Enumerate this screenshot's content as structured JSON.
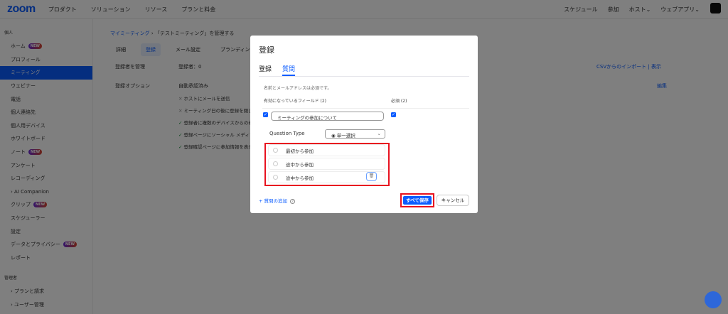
{
  "header": {
    "logo": "zoom",
    "nav": [
      "プロダクト",
      "ソリューション",
      "リソース",
      "プランと料金"
    ],
    "right": [
      "スケジュール",
      "参加",
      "ホスト⌄",
      "ウェブアプリ⌄"
    ]
  },
  "sidebar": {
    "section_personal": "個人",
    "items": [
      {
        "label": "ホーム",
        "new": "NEW"
      },
      {
        "label": "プロフィール"
      },
      {
        "label": "ミーティング",
        "active": true
      },
      {
        "label": "ウェビナー"
      },
      {
        "label": "電話"
      },
      {
        "label": "個人連絡先"
      },
      {
        "label": "個人用デバイス"
      },
      {
        "label": "ホワイトボード"
      },
      {
        "label": "ノート",
        "new": "NEW"
      },
      {
        "label": "アンケート"
      },
      {
        "label": "レコーディング"
      },
      {
        "label": "› AI Companion"
      },
      {
        "label": "クリップ",
        "new": "NEW"
      },
      {
        "label": "スケジューラー"
      },
      {
        "label": "設定"
      },
      {
        "label": "データとプライバシー",
        "new": "NEW"
      },
      {
        "label": "レポート"
      }
    ],
    "section_admin": "管理者",
    "admin_items": [
      "› プランと請求",
      "› ユーザー管理"
    ]
  },
  "main": {
    "breadcrumb_link": "マイミーティング",
    "breadcrumb_sep": " › ",
    "breadcrumb_current": "「テストミーティング」を管理する",
    "tabs": [
      "詳細",
      "登録",
      "メール設定",
      "ブランディング"
    ],
    "manage_label": "登録者を管理",
    "registrants": "登録者：0",
    "csv_import": "CSVからのインポート",
    "view": "表示",
    "options_label": "登録オプション",
    "edit": "編集",
    "auto_approve": "自動承認済み",
    "options": [
      {
        "mark": "✕",
        "text": "ホストにメールを送信"
      },
      {
        "mark": "✕",
        "text": "ミーティング日の後に登録を閉じ"
      },
      {
        "mark": "✓",
        "text": "登録者に複数のデバイスからの参"
      },
      {
        "mark": "✓",
        "text": "登録ページにソーシャル メディア"
      },
      {
        "mark": "✓",
        "text": "登録確認ページに参加情報を表示"
      }
    ]
  },
  "modal": {
    "title": "登録",
    "tabs": [
      "登録",
      "質問"
    ],
    "note": "名前とメールアドレスは必須です。",
    "fields_header": "有効になっているフィールド (2)",
    "required_header": "必須 (2)",
    "question": "ミーティングの参加について",
    "question_type_label": "Question Type",
    "question_type": "単一選択",
    "answers": [
      "最初から参加",
      "途中から参加",
      "途中から参加"
    ],
    "add_question": "質問の追加",
    "save_all": "すべて保存",
    "cancel": "キャンセル"
  }
}
